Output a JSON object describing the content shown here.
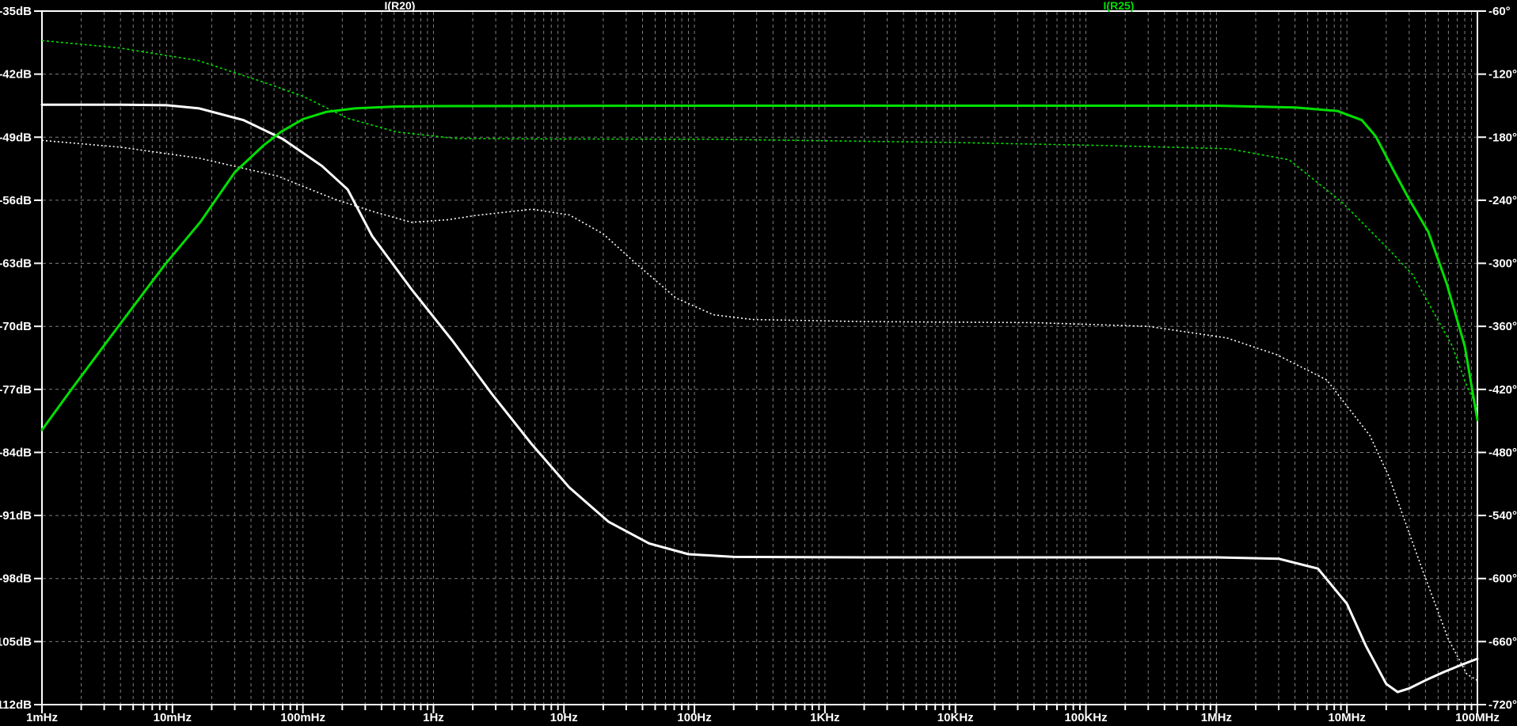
{
  "window": {
    "background": "#000000"
  },
  "chart_data": {
    "type": "line",
    "title": "",
    "x_axis": {
      "scale": "log",
      "unit": "Hz",
      "min": 0.001,
      "max": 100000000,
      "tick_labels": [
        "1mHz",
        "10mHz",
        "100mHz",
        "1Hz",
        "10Hz",
        "100Hz",
        "1KHz",
        "10KHz",
        "100KHz",
        "1MHz",
        "10MHz",
        "100MHz"
      ]
    },
    "y_axis_left": {
      "unit": "dB",
      "max": -35,
      "min": -112,
      "step": 7,
      "tick_labels": [
        "-35dB",
        "-42dB",
        "-49dB",
        "-56dB",
        "-63dB",
        "-70dB",
        "-77dB",
        "-84dB",
        "-91dB",
        "-98dB",
        "-105dB",
        "-112dB"
      ]
    },
    "y_axis_right": {
      "unit": "deg",
      "max": -60,
      "min": -720,
      "step": 60,
      "tick_labels": [
        "-60°",
        "-120°",
        "-180°",
        "-240°",
        "-300°",
        "-360°",
        "-420°",
        "-480°",
        "-540°",
        "-600°",
        "-660°",
        "-720°"
      ]
    },
    "grid": {
      "color": "#7e7e7e",
      "style": "dashed"
    },
    "legend": [
      {
        "name": "I(R20)",
        "color": "#ffffff"
      },
      {
        "name": "I(R25)",
        "color": "#00e000"
      }
    ],
    "series": [
      {
        "name": "I(R20)",
        "quantity": "magnitude",
        "axis": "left",
        "style": "solid",
        "color": "#ffffff",
        "points": [
          [
            0.001,
            -45.4
          ],
          [
            0.004,
            -45.4
          ],
          [
            0.009,
            -45.45
          ],
          [
            0.016,
            -45.8
          ],
          [
            0.035,
            -47.1
          ],
          [
            0.07,
            -49.2
          ],
          [
            0.14,
            -52.2
          ],
          [
            0.22,
            -54.8
          ],
          [
            0.34,
            -60
          ],
          [
            0.68,
            -65.9
          ],
          [
            1.4,
            -71.6
          ],
          [
            2.8,
            -77.5
          ],
          [
            5.6,
            -83
          ],
          [
            11,
            -87.9
          ],
          [
            22,
            -91.7
          ],
          [
            45,
            -94.1
          ],
          [
            90,
            -95.3
          ],
          [
            200,
            -95.6
          ],
          [
            2000,
            -95.65
          ],
          [
            50000,
            -95.65
          ],
          [
            1000000,
            -95.65
          ],
          [
            3000000,
            -95.8
          ],
          [
            6000000,
            -96.9
          ],
          [
            10000000,
            -100.8
          ],
          [
            14000000,
            -105.5
          ],
          [
            20000000,
            -109.7
          ],
          [
            24500000,
            -110.6
          ],
          [
            30000000,
            -110.2
          ],
          [
            40000000,
            -109.3
          ],
          [
            55000000,
            -108.4
          ],
          [
            75000000,
            -107.6
          ],
          [
            100000000,
            -106.9
          ]
        ]
      },
      {
        "name": "I(R20)",
        "quantity": "phase",
        "axis": "right",
        "style": "dashed",
        "color": "#ffffff",
        "points": [
          [
            0.001,
            -183
          ],
          [
            0.004,
            -189.5
          ],
          [
            0.016,
            -200
          ],
          [
            0.064,
            -217
          ],
          [
            0.175,
            -239
          ],
          [
            0.35,
            -251
          ],
          [
            0.68,
            -261
          ],
          [
            1.3,
            -258.5
          ],
          [
            2.1,
            -254.5
          ],
          [
            5.7,
            -248.5
          ],
          [
            11,
            -254
          ],
          [
            20,
            -272
          ],
          [
            34,
            -298
          ],
          [
            72,
            -333
          ],
          [
            140,
            -349
          ],
          [
            280,
            -353.5
          ],
          [
            2000,
            -355.5
          ],
          [
            40000,
            -356.5
          ],
          [
            300000,
            -360
          ],
          [
            1200000,
            -371
          ],
          [
            2900000,
            -387
          ],
          [
            7000000,
            -411
          ],
          [
            15000000,
            -464
          ],
          [
            21000000,
            -503
          ],
          [
            27000000,
            -541
          ],
          [
            38000000,
            -592
          ],
          [
            60000000,
            -658
          ],
          [
            83000000,
            -691
          ],
          [
            100000000,
            -697
          ]
        ]
      },
      {
        "name": "I(R25)",
        "quantity": "magnitude",
        "axis": "left",
        "style": "solid",
        "color": "#00e000",
        "points": [
          [
            0.001,
            -81.5
          ],
          [
            0.0017,
            -76.9
          ],
          [
            0.0039,
            -69.9
          ],
          [
            0.0087,
            -63.2
          ],
          [
            0.0164,
            -58.4
          ],
          [
            0.03,
            -52.9
          ],
          [
            0.05,
            -49.9
          ],
          [
            0.068,
            -48.4
          ],
          [
            0.1,
            -47
          ],
          [
            0.15,
            -46.2
          ],
          [
            0.25,
            -45.8
          ],
          [
            0.5,
            -45.6
          ],
          [
            1,
            -45.55
          ],
          [
            100,
            -45.5
          ],
          [
            100000,
            -45.5
          ],
          [
            1000000,
            -45.5
          ],
          [
            4000000,
            -45.7
          ],
          [
            8500000,
            -46.1
          ],
          [
            13000000,
            -47.1
          ],
          [
            16600000,
            -48.9
          ],
          [
            23000000,
            -52.8
          ],
          [
            30000000,
            -55.9
          ],
          [
            42000000,
            -59.5
          ],
          [
            58000000,
            -65.2
          ],
          [
            80000000,
            -72.2
          ],
          [
            100000000,
            -80.4
          ]
        ]
      },
      {
        "name": "I(R25)",
        "quantity": "phase",
        "axis": "right",
        "style": "dashed",
        "color": "#00e000",
        "points": [
          [
            0.001,
            -88
          ],
          [
            0.0039,
            -95
          ],
          [
            0.0157,
            -107
          ],
          [
            0.048,
            -127
          ],
          [
            0.1,
            -141
          ],
          [
            0.22,
            -162
          ],
          [
            0.52,
            -175
          ],
          [
            1.5,
            -181.3
          ],
          [
            8,
            -181.7
          ],
          [
            140,
            -182
          ],
          [
            9000,
            -185
          ],
          [
            150000,
            -188
          ],
          [
            1240000,
            -191
          ],
          [
            3600000,
            -201.5
          ],
          [
            9100000,
            -241.5
          ],
          [
            21000000,
            -287
          ],
          [
            32000000,
            -311
          ],
          [
            64000000,
            -378.5
          ],
          [
            84000000,
            -418.5
          ],
          [
            100000000,
            -437.5
          ]
        ]
      }
    ]
  }
}
